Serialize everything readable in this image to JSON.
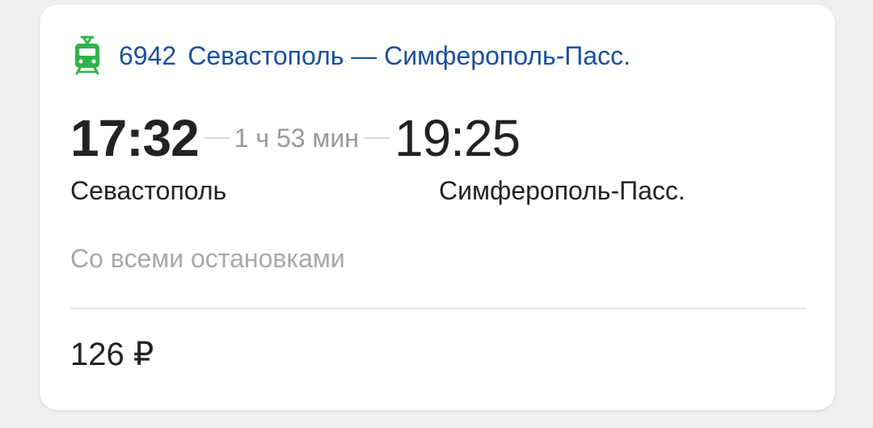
{
  "header": {
    "icon": "train-icon",
    "train_number": "6942",
    "route_title": "Севастополь — Симферополь-Пасс."
  },
  "schedule": {
    "departure_time": "17:32",
    "duration": "1 ч 53 мин",
    "arrival_time": "19:25",
    "departure_station": "Севастополь",
    "arrival_station": "Симферополь-Пасс."
  },
  "stops_info": "Со всеми остановками",
  "price": "126 ₽",
  "colors": {
    "icon": "#2fb34a",
    "link": "#1a4fa0",
    "muted": "#a8a8a8",
    "text": "#222222"
  }
}
